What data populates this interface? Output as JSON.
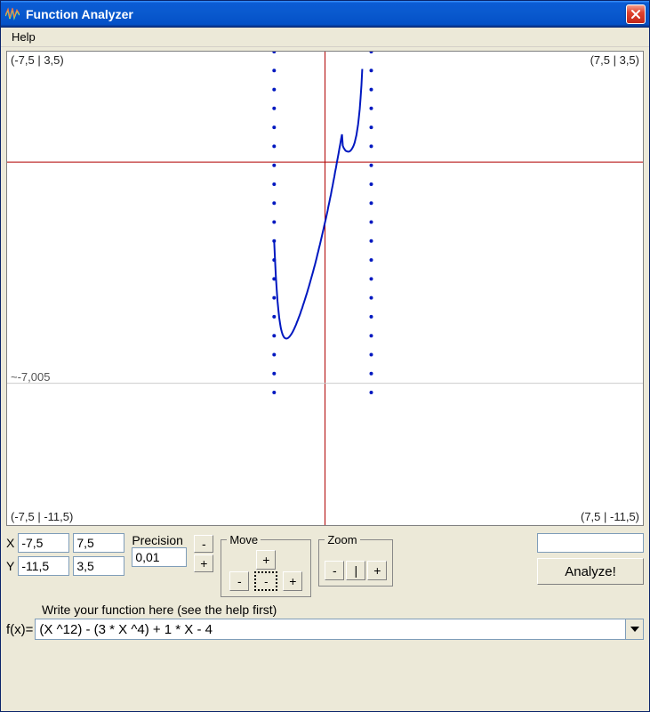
{
  "window": {
    "title": "Function Analyzer"
  },
  "menu": {
    "help": "Help"
  },
  "plot": {
    "top_left": "(-7,5 | 3,5)",
    "top_right": "(7,5 | 3,5)",
    "bottom_left": "(-7,5 | -11,5)",
    "bottom_right": "(7,5 | -11,5)",
    "mid_label": "~-7,005"
  },
  "range": {
    "x_label": "X",
    "y_label": "Y",
    "x_min": "-7,5",
    "x_max": "7,5",
    "y_min": "-11,5",
    "y_max": "3,5"
  },
  "precision": {
    "label": "Precision",
    "value": "0,01"
  },
  "pm": {
    "minus": "-",
    "plus": "+"
  },
  "move": {
    "legend": "Move",
    "plus": "+",
    "left": "-",
    "minus": "-",
    "right": "+"
  },
  "zoom": {
    "legend": "Zoom",
    "out": "-",
    "reset": "|",
    "in": "+"
  },
  "analyze": {
    "button": "Analyze!"
  },
  "fn": {
    "hint": "Write your function here (see the help first)",
    "label": "f(x)=",
    "value": "(X ^12) - (3 * X ^4) + 1 * X - 4"
  },
  "chart_data": {
    "type": "line",
    "title": "",
    "xlabel": "",
    "ylabel": "",
    "xlim": [
      -7.5,
      7.5
    ],
    "ylim": [
      -11.5,
      3.5
    ],
    "axes_at": {
      "x": 0,
      "y": 0
    },
    "annotations": [
      {
        "text": "~-7,005",
        "x": -7.5,
        "y": -7.005
      }
    ],
    "series": [
      {
        "name": "f(x) = (X^12) - (3*X^4) + 1*X - 4",
        "x": [
          -1.2,
          -1.18,
          -1.16,
          -1.14,
          -1.12,
          -1.1,
          -1.08,
          -1.06,
          -1.04,
          -1.02,
          -1.0,
          -0.98,
          -0.96,
          -0.94,
          -0.92,
          -0.9,
          -0.88,
          -0.86,
          -0.84,
          -0.82,
          -0.8,
          -0.78,
          -0.76,
          -0.74,
          -0.72,
          -0.7,
          -0.68,
          -0.66,
          -0.64,
          -0.62,
          -0.6,
          -0.58,
          -0.56,
          -0.54,
          -0.52,
          -0.5,
          -0.48,
          -0.46,
          -0.44,
          -0.42,
          -0.4,
          -0.38,
          -0.36,
          -0.34,
          -0.32,
          -0.3,
          -0.28,
          -0.26,
          -0.24,
          -0.22,
          -0.2,
          -0.18,
          -0.16,
          -0.14,
          -0.12,
          -0.1,
          -0.08,
          -0.06,
          -0.04,
          -0.02,
          0.0,
          0.02,
          0.04,
          0.06,
          0.08,
          0.1,
          0.12,
          0.14,
          0.16,
          0.18,
          0.2,
          0.22,
          0.24,
          0.26,
          0.28,
          0.3,
          0.32,
          0.34,
          0.36,
          0.38,
          0.4,
          0.42,
          0.44,
          0.46,
          0.48,
          0.5,
          0.52,
          0.54,
          0.56,
          0.58,
          0.6,
          0.62,
          0.64,
          0.66,
          0.68,
          0.7,
          0.72,
          0.74,
          0.76,
          0.78,
          0.8,
          0.82,
          0.84,
          0.86,
          0.88,
          0.9,
          0.92,
          0.94,
          0.96,
          0.98,
          1.0,
          1.02,
          1.04,
          1.06,
          1.08,
          1.1
        ],
        "values": [
          -2.49,
          -3.1,
          -3.61,
          -4.04,
          -4.4,
          -4.69,
          -4.93,
          -5.12,
          -5.27,
          -5.38,
          -5.46,
          -5.52,
          -5.56,
          -5.58,
          -5.59,
          -5.59,
          -5.58,
          -5.56,
          -5.53,
          -5.5,
          -5.46,
          -5.42,
          -5.37,
          -5.32,
          -5.26,
          -5.2,
          -5.14,
          -5.07,
          -5.0,
          -4.93,
          -4.86,
          -4.78,
          -4.7,
          -4.63,
          -4.54,
          -4.46,
          -4.38,
          -4.29,
          -4.21,
          -4.12,
          -4.03,
          -3.94,
          -3.85,
          -3.75,
          -3.66,
          -3.56,
          -3.46,
          -3.36,
          -3.26,
          -3.16,
          -3.05,
          -2.94,
          -2.83,
          -2.72,
          -2.61,
          -2.5,
          -2.38,
          -2.27,
          -2.15,
          -2.03,
          -1.91,
          -1.79,
          -1.67,
          -1.54,
          -1.41,
          -1.28,
          -1.15,
          -1.02,
          -0.88,
          -0.74,
          -0.6,
          -0.46,
          -0.31,
          -0.17,
          -0.02,
          0.13,
          0.28,
          0.43,
          0.58,
          0.73,
          0.88,
          0.52,
          0.45,
          0.41,
          0.37,
          0.35,
          0.34,
          0.33,
          0.33,
          0.34,
          0.36,
          0.39,
          0.43,
          0.48,
          0.54,
          0.62,
          0.73,
          0.85,
          1.01,
          1.19,
          1.42,
          1.69,
          2.03,
          2.44,
          2.95,
          3.56,
          4.31,
          5.21,
          6.3,
          7.62,
          9.21,
          11.11,
          13.41,
          16.16,
          19.46,
          23.41
        ]
      }
    ]
  }
}
